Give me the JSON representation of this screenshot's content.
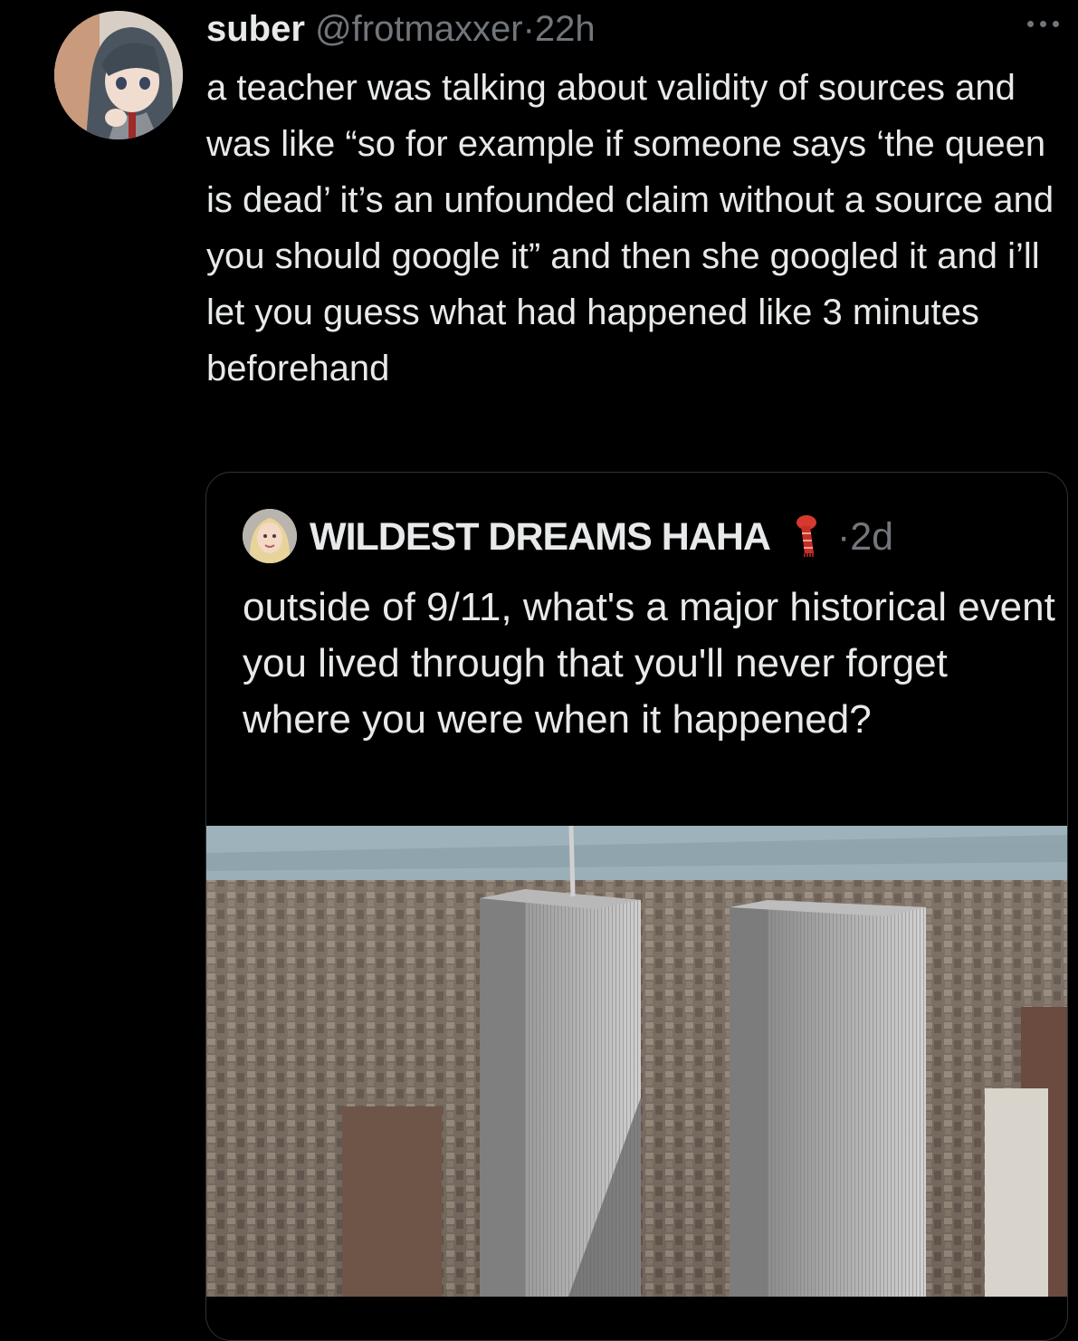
{
  "tweet": {
    "display_name": "suber",
    "handle": "@frotmaxxer",
    "separator": "·",
    "time": "22h",
    "text": "a teacher was talking about validity of sources and was like “so for example if someone says ‘the queen is dead’ it’s an unfounded claim without a source and you should google it” and then she googled it and i’ll let you guess what had happened like 3 minutes beforehand",
    "more_icon": "more-horizontal-icon"
  },
  "quoted_tweet": {
    "display_name": "WILDEST DREAMS HAHA",
    "emoji": "scarf-emoji",
    "separator": "·",
    "time": "2d",
    "text": "outside of 9/11, what's a major historical event you lived through that you'll never forget where you were when it happened?",
    "media": "aerial-photo-twin-towers"
  },
  "colors": {
    "background": "#000000",
    "primary_text": "#e7e9ea",
    "secondary_text": "#71767b",
    "border": "#2f3336"
  }
}
